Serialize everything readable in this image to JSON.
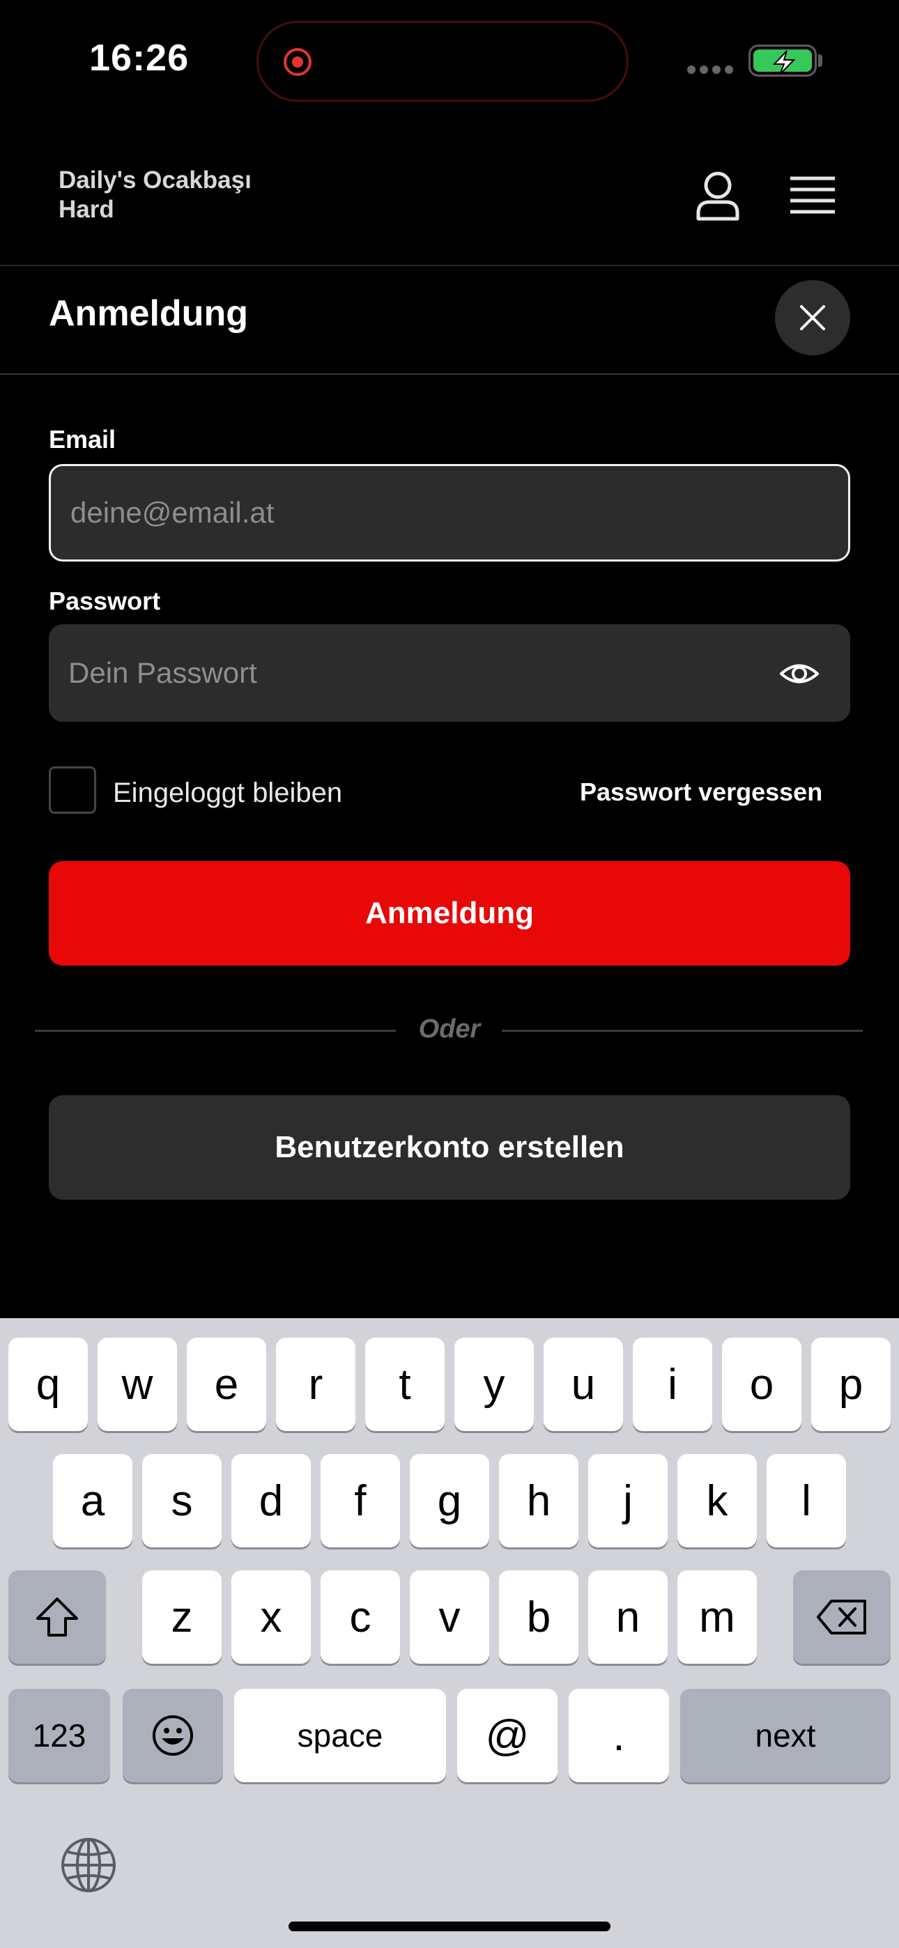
{
  "status_bar": {
    "time": "16:26"
  },
  "header": {
    "brand_line1": "Daily's Ocakbaşı",
    "brand_line2": "Hard"
  },
  "login": {
    "title": "Anmeldung",
    "email_label": "Email",
    "email_placeholder": "deine@email.at",
    "password_label": "Passwort",
    "password_placeholder": "Dein Passwort",
    "stay_logged_in": "Eingeloggt bleiben",
    "forgot_password": "Passwort vergessen",
    "submit_label": "Anmeldung",
    "or_text": "Oder",
    "create_account": "Benutzerkonto erstellen"
  },
  "keyboard": {
    "row1": [
      "q",
      "w",
      "e",
      "r",
      "t",
      "y",
      "u",
      "i",
      "o",
      "p"
    ],
    "row2": [
      "a",
      "s",
      "d",
      "f",
      "g",
      "h",
      "j",
      "k",
      "l"
    ],
    "row3": [
      "z",
      "x",
      "c",
      "v",
      "b",
      "n",
      "m"
    ],
    "numbers_key": "123",
    "space_key": "space",
    "at_key": "@",
    "dot_key": ".",
    "next_key": "next"
  },
  "colors": {
    "accent": "#e80808",
    "background": "#000000",
    "field": "#2c2c2c",
    "keyboard": "#d1d3d9"
  }
}
